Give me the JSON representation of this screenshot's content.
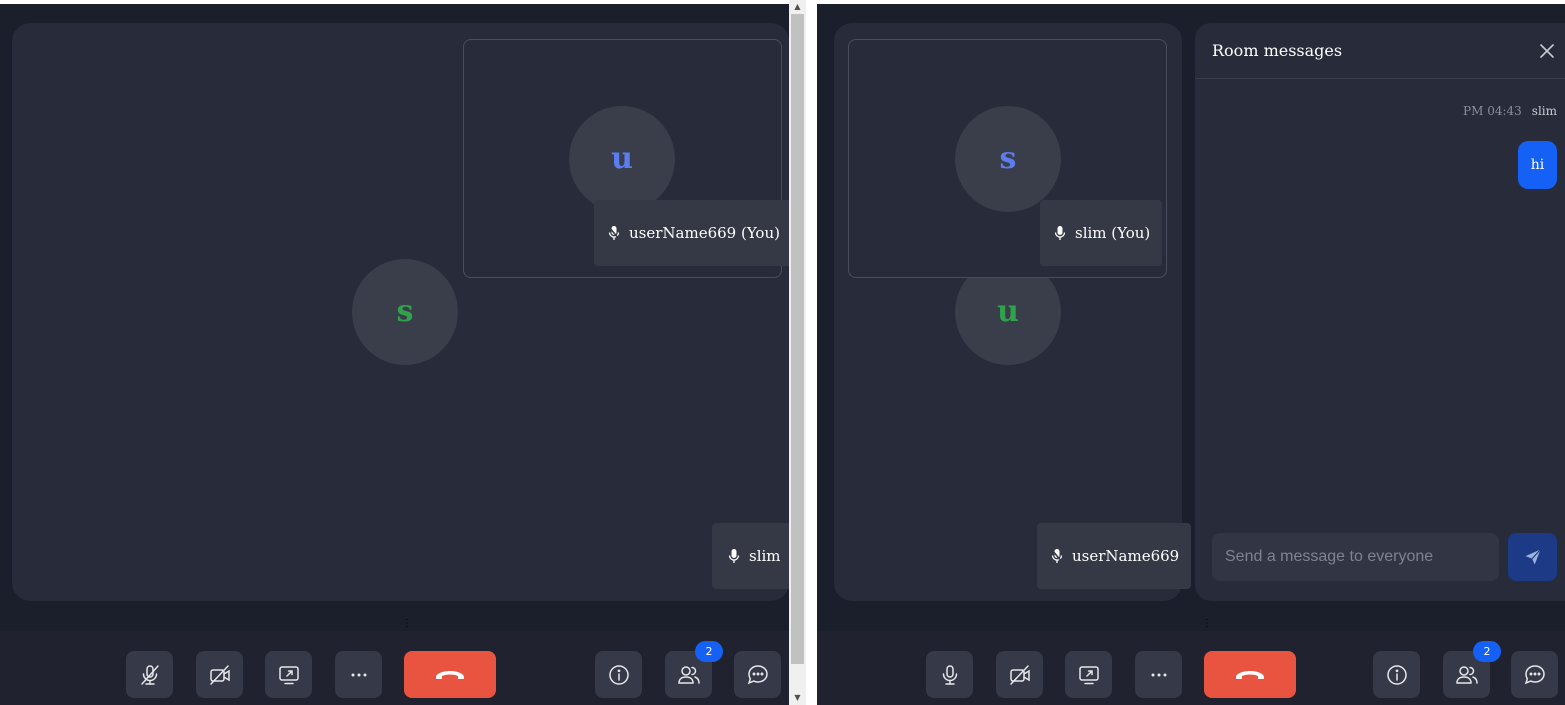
{
  "left_window": {
    "main_avatar_letter": "s",
    "pip_avatar_letter": "u",
    "pip_name": "userName669 (You)",
    "remote_name": "slim",
    "toolbar": {
      "participants_count": "2"
    }
  },
  "right_window": {
    "pip_avatar_letter": "s",
    "main_avatar_letter": "u",
    "pip_name": "slim (You)",
    "remote_name": "userName669",
    "toolbar": {
      "participants_count": "2"
    },
    "chat": {
      "title": "Room messages",
      "messages": [
        {
          "time": "PM 04:43",
          "sender": "slim",
          "text": "hi"
        }
      ],
      "input_placeholder": "Send a message to everyone"
    }
  },
  "colors": {
    "background": "#1b1f2b",
    "stage": "#272b3a",
    "end_call": "#e8543f",
    "accent_blue": "#1560f5",
    "avatar_letter_blue": "#5b7df0",
    "avatar_letter_green": "#2fa24b"
  },
  "icons": [
    "mic-off-icon",
    "mic-icon",
    "camera-off-icon",
    "share-screen-icon",
    "more-icon",
    "end-call-icon",
    "info-icon",
    "participants-icon",
    "chat-icon",
    "close-icon",
    "send-icon"
  ]
}
